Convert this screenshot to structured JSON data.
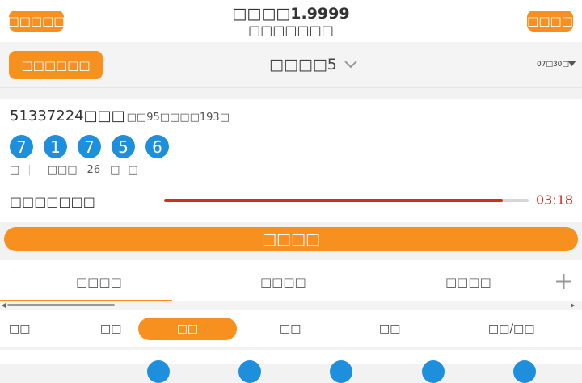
{
  "header": {
    "left_button": "□□□□□",
    "title": "□□□□1.9999",
    "subtitle": "□□□□□□□",
    "right_button": "□□□□"
  },
  "lottery_bar": {
    "left_button": "□□□□□□",
    "game_name": "□□□□5",
    "date": "07□30□"
  },
  "draw": {
    "issue": "51337224□□□",
    "info": "□□95□□□□193□",
    "numbers": [
      "7",
      "1",
      "7",
      "5",
      "6"
    ],
    "stats": [
      "□",
      "□□□",
      "26",
      "□",
      "□"
    ],
    "countdown_label": "□□□□□□□",
    "countdown_time": "03:18",
    "progress": 0.93
  },
  "main_button": "□□□□",
  "tabs": [
    "□□□□",
    "□□□□",
    "□□□□"
  ],
  "subtabs": [
    "□□",
    "□□",
    "□□",
    "□□",
    "□□",
    "□□/□□"
  ],
  "colors": {
    "accent": "#f7901e",
    "ball": "#1e8fdc",
    "countdown": "#d62b1f"
  }
}
